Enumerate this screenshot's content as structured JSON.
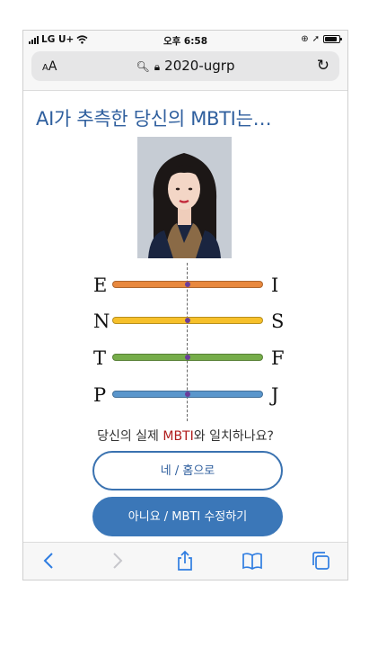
{
  "status_bar": {
    "carrier": "LG U+",
    "time": "오후 6:58"
  },
  "browser": {
    "text_size": "AA",
    "url": "2020-ugrp"
  },
  "page": {
    "title": "AI가 추측한 당신의 MBTI는…",
    "question_prefix": "당신의 실제 ",
    "question_highlight": "MBTI",
    "question_suffix": "와 일치하나요?",
    "yes_button": "네 / 홈으로",
    "no_button": "아니요 / MBTI 수정하기"
  },
  "mbti_axes": [
    {
      "left": "E",
      "right": "I",
      "color": "#e8883e",
      "value": 0.5
    },
    {
      "left": "N",
      "right": "S",
      "color": "#f6c02a",
      "value": 0.5
    },
    {
      "left": "T",
      "right": "F",
      "color": "#76ad4a",
      "value": 0.5
    },
    {
      "left": "P",
      "right": "J",
      "color": "#5a96cc",
      "value": 0.5
    }
  ],
  "colors": {
    "title": "#2f5f9e",
    "accent": "#3b77b8",
    "highlight": "#b01c1c",
    "marker": "#6a3d9a"
  },
  "toolbar_icons": [
    "back-icon",
    "forward-icon",
    "share-icon",
    "bookmarks-icon",
    "tabs-icon"
  ]
}
